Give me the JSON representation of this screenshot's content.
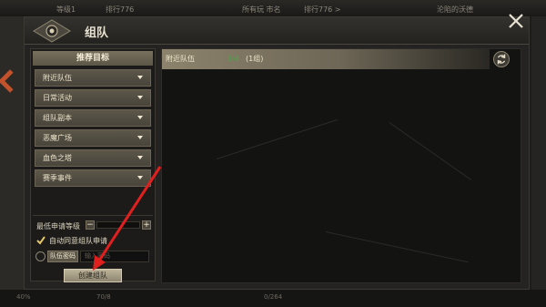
{
  "hud": {
    "level": "等级1",
    "top_number": "排行776",
    "top_mid": "所有玩 市名",
    "top_rank": "排行776 >",
    "location": "沦陷的沃德",
    "bottom_left": "40%",
    "bottom_mid": "70/8",
    "bottom_center": "0/264"
  },
  "window": {
    "title": "组队"
  },
  "left_panel": {
    "header": "推荐目标",
    "categories": [
      {
        "label": "附近队伍"
      },
      {
        "label": "日常活动"
      },
      {
        "label": "组队副本"
      },
      {
        "label": "恶魔广场"
      },
      {
        "label": "血色之塔"
      },
      {
        "label": "赛季事件"
      }
    ]
  },
  "settings": {
    "min_level_label": "最低申请等级",
    "minus": "−",
    "plus": "+",
    "auto_accept_label": "自动同意组队申请",
    "auto_accept_checked": true,
    "password_tag": "队伍密码",
    "password_placeholder": "输入密码",
    "create_button": "创建组队"
  },
  "team_list": {
    "rows": [
      {
        "name": "附近队伍",
        "count": "1/4",
        "sub": "(1组)"
      }
    ]
  },
  "colors": {
    "accent_green": "#4fa34a",
    "arrow_red": "#e01f1f",
    "check_gold": "#e4c76a"
  }
}
